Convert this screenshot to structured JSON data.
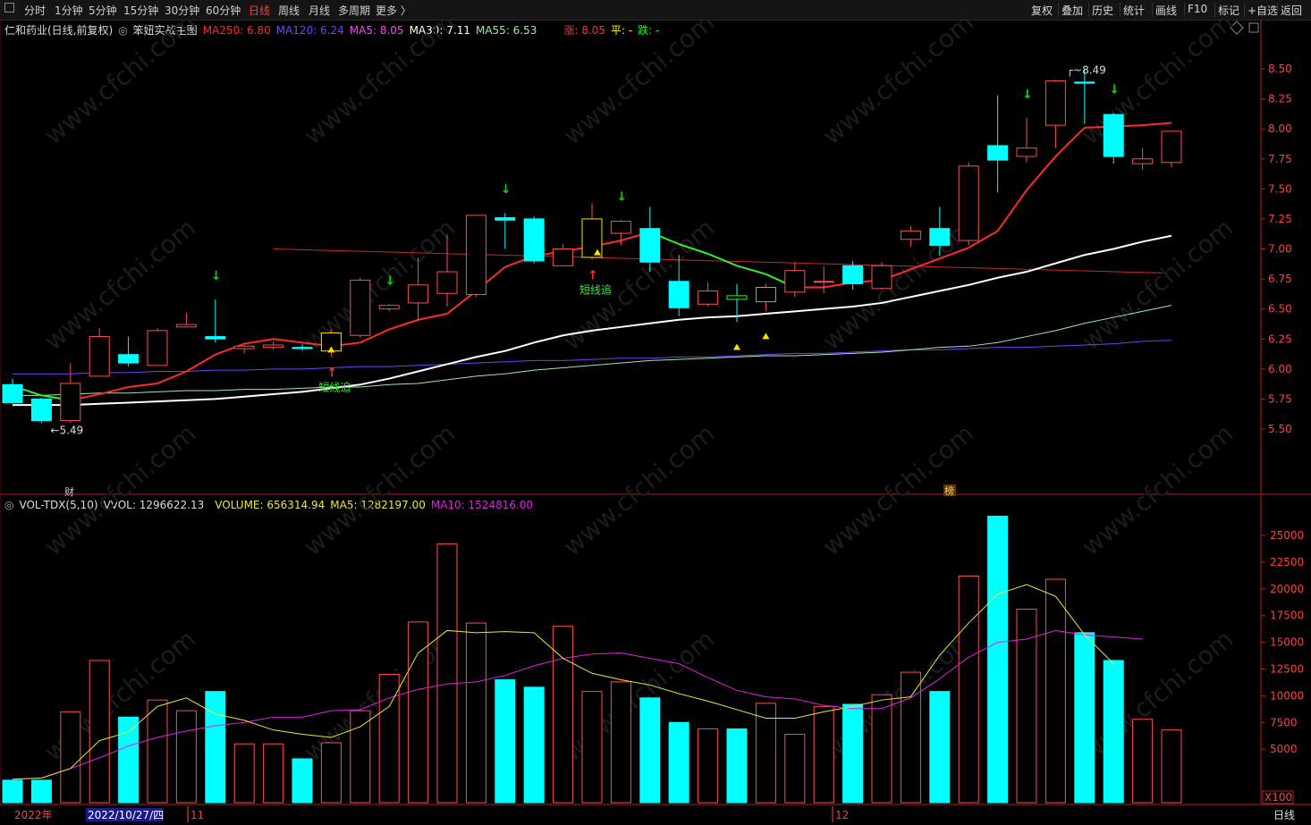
{
  "period_tabs": [
    "分时",
    "1分钟",
    "5分钟",
    "15分钟",
    "30分钟",
    "60分钟",
    "日线",
    "周线",
    "月线",
    "多周期",
    "更多 〉"
  ],
  "active_period": "日线",
  "toolbar": [
    "复权",
    "叠加",
    "历史",
    "统计",
    "画线",
    "F10",
    "标记",
    "+自选",
    "返回"
  ],
  "main_legend": {
    "stock": "仁和药业(日线,前复权)",
    "indicator": "笨妞实战主图",
    "ma250": "MA250: 6.80",
    "ma120": "MA120: 6.24",
    "ma5": "MA5: 8.05",
    "ma30": "MA30: 7.11",
    "ma55": "MA55: 6.53",
    "zhang": "涨: 8.05",
    "ping": "平: -",
    "die": "跌: -"
  },
  "vol_legend": {
    "name": "VOL-TDX(5,10)",
    "vvol": "VVOL: 1296622.13",
    "volume": "VOLUME: 656314.94",
    "ma5": "MA5: 1282197.00",
    "ma10": "MA10: 1524816.00"
  },
  "colors": {
    "up": "#ff4d4d",
    "down": "#00ffff",
    "ma5": "#ff2a2a",
    "ma30": "#ffffff",
    "ma55": "#9fe8a8",
    "ma120": "#7a3cff",
    "ma250": "#c82828",
    "vma5": "#e8e838",
    "vma10": "#e020e0",
    "signal": "#00dd00",
    "tri": "#ffe000",
    "zhuiArrow": "#ff2a2a"
  },
  "x_axis": {
    "labels": [
      "2022年",
      "2022/10/27/四",
      "11",
      "12"
    ],
    "bottom_right": "日线"
  },
  "vol_unit": "X100",
  "markers": {
    "cai": "财",
    "bang": "榜"
  },
  "chart_data": {
    "type": "candlestick",
    "price_axis": {
      "ticks": [
        5.5,
        5.75,
        6.0,
        6.25,
        6.5,
        6.75,
        7.0,
        7.25,
        7.5,
        7.75,
        8.0,
        8.25,
        8.5
      ]
    },
    "volume_axis": {
      "ticks": [
        5000,
        7500,
        10000,
        12500,
        15000,
        17500,
        20000,
        22500,
        25000
      ]
    },
    "candles": [
      {
        "o": 5.87,
        "h": 5.92,
        "l": 5.71,
        "c": 5.72,
        "v": 2100
      },
      {
        "o": 5.75,
        "h": 5.76,
        "l": 5.55,
        "c": 5.57,
        "v": 2100
      },
      {
        "o": 5.57,
        "h": 6.05,
        "l": 5.55,
        "c": 5.88,
        "v": 8500
      },
      {
        "o": 5.94,
        "h": 6.34,
        "l": 5.94,
        "c": 6.27,
        "v": 13300
      },
      {
        "o": 6.12,
        "h": 6.27,
        "l": 6.02,
        "c": 6.05,
        "v": 8000
      },
      {
        "o": 6.03,
        "h": 6.34,
        "l": 6.03,
        "c": 6.32,
        "v": 9600
      },
      {
        "o": 6.35,
        "h": 6.47,
        "l": 6.35,
        "c": 6.37,
        "v": 8600
      },
      {
        "o": 6.27,
        "h": 6.58,
        "l": 6.22,
        "c": 6.25,
        "v": 10400
      },
      {
        "o": 6.17,
        "h": 6.2,
        "l": 6.13,
        "c": 6.19,
        "v": 5500
      },
      {
        "o": 6.18,
        "h": 6.23,
        "l": 6.16,
        "c": 6.2,
        "v": 5500
      },
      {
        "o": 6.18,
        "h": 6.21,
        "l": 6.15,
        "c": 6.17,
        "v": 4100
      },
      {
        "o": 6.15,
        "h": 6.33,
        "l": 6.1,
        "c": 6.3,
        "v": 5600
      },
      {
        "o": 6.28,
        "h": 6.76,
        "l": 6.26,
        "c": 6.74,
        "v": 8600
      },
      {
        "o": 6.5,
        "h": 6.54,
        "l": 6.48,
        "c": 6.53,
        "v": 12000
      },
      {
        "o": 6.55,
        "h": 6.93,
        "l": 6.4,
        "c": 6.7,
        "v": 16900
      },
      {
        "o": 6.63,
        "h": 7.12,
        "l": 6.52,
        "c": 6.81,
        "v": 24200
      },
      {
        "o": 6.62,
        "h": 7.28,
        "l": 6.6,
        "c": 7.28,
        "v": 16800
      },
      {
        "o": 7.26,
        "h": 7.3,
        "l": 7.0,
        "c": 7.24,
        "v": 11500
      },
      {
        "o": 7.25,
        "h": 7.27,
        "l": 6.88,
        "c": 6.9,
        "v": 10800
      },
      {
        "o": 6.86,
        "h": 7.04,
        "l": 6.86,
        "c": 7.0,
        "v": 16500
      },
      {
        "o": 6.93,
        "h": 7.38,
        "l": 6.91,
        "c": 7.25,
        "v": 10400
      },
      {
        "o": 7.13,
        "h": 7.24,
        "l": 7.03,
        "c": 7.23,
        "v": 11300
      },
      {
        "o": 7.17,
        "h": 7.35,
        "l": 6.81,
        "c": 6.89,
        "v": 9800
      },
      {
        "o": 6.73,
        "h": 6.95,
        "l": 6.44,
        "c": 6.51,
        "v": 7500
      },
      {
        "o": 6.54,
        "h": 6.72,
        "l": 6.52,
        "c": 6.65,
        "v": 6900
      },
      {
        "o": 6.61,
        "h": 6.71,
        "l": 6.39,
        "c": 6.58,
        "v": 6900
      },
      {
        "o": 6.56,
        "h": 6.71,
        "l": 6.48,
        "c": 6.68,
        "v": 9300
      },
      {
        "o": 6.64,
        "h": 6.89,
        "l": 6.6,
        "c": 6.82,
        "v": 6400
      },
      {
        "o": 6.73,
        "h": 6.86,
        "l": 6.63,
        "c": 6.73,
        "v": 9000
      },
      {
        "o": 6.86,
        "h": 6.9,
        "l": 6.66,
        "c": 6.71,
        "v": 9200
      },
      {
        "o": 6.67,
        "h": 6.89,
        "l": 6.66,
        "c": 6.86,
        "v": 10100
      },
      {
        "o": 7.08,
        "h": 7.19,
        "l": 7.02,
        "c": 7.15,
        "v": 12200
      },
      {
        "o": 7.17,
        "h": 7.35,
        "l": 6.94,
        "c": 7.03,
        "v": 10400
      },
      {
        "o": 7.07,
        "h": 7.72,
        "l": 7.03,
        "c": 7.69,
        "v": 21200
      },
      {
        "o": 7.86,
        "h": 8.28,
        "l": 7.47,
        "c": 7.74,
        "v": 26800
      },
      {
        "o": 7.77,
        "h": 8.09,
        "l": 7.72,
        "c": 7.84,
        "v": 18100
      },
      {
        "o": 8.03,
        "h": 8.41,
        "l": 7.84,
        "c": 8.4,
        "v": 20900
      },
      {
        "o": 8.39,
        "h": 8.49,
        "l": 8.04,
        "c": 8.38,
        "v": 15900
      },
      {
        "o": 8.12,
        "h": 8.13,
        "l": 7.71,
        "c": 7.77,
        "v": 13300
      },
      {
        "o": 7.71,
        "h": 7.84,
        "l": 7.66,
        "c": 7.75,
        "v": 7800
      },
      {
        "o": 7.72,
        "h": 7.98,
        "l": 7.68,
        "c": 7.98,
        "v": 6800
      }
    ],
    "ma5": [
      5.86,
      5.78,
      5.74,
      5.79,
      5.85,
      5.88,
      5.98,
      6.12,
      6.21,
      6.25,
      6.22,
      6.19,
      6.22,
      6.33,
      6.41,
      6.46,
      6.65,
      6.85,
      6.94,
      6.98,
      7.02,
      7.07,
      7.14,
      7.04,
      6.96,
      6.86,
      6.79,
      6.68,
      6.68,
      6.72,
      6.74,
      6.83,
      6.92,
      7.01,
      7.15,
      7.49,
      7.77,
      8.01,
      8.02,
      8.03,
      8.05
    ],
    "ma30": [
      5.7,
      5.7,
      5.7,
      5.71,
      5.72,
      5.73,
      5.74,
      5.75,
      5.77,
      5.79,
      5.81,
      5.84,
      5.87,
      5.92,
      5.98,
      6.04,
      6.1,
      6.15,
      6.22,
      6.28,
      6.32,
      6.35,
      6.38,
      6.41,
      6.43,
      6.44,
      6.46,
      6.48,
      6.5,
      6.52,
      6.55,
      6.6,
      6.65,
      6.7,
      6.76,
      6.81,
      6.88,
      6.95,
      7.0,
      7.06,
      7.11
    ],
    "ma55": [
      5.78,
      5.78,
      5.79,
      5.8,
      5.8,
      5.81,
      5.82,
      5.82,
      5.83,
      5.83,
      5.84,
      5.85,
      5.85,
      5.87,
      5.88,
      5.91,
      5.94,
      5.96,
      5.99,
      6.01,
      6.03,
      6.05,
      6.07,
      6.08,
      6.09,
      6.1,
      6.11,
      6.11,
      6.12,
      6.13,
      6.14,
      6.16,
      6.18,
      6.19,
      6.22,
      6.27,
      6.32,
      6.38,
      6.43,
      6.48,
      6.53
    ],
    "ma120": [
      5.96,
      5.96,
      5.96,
      5.97,
      5.97,
      5.98,
      5.98,
      5.99,
      5.99,
      6.0,
      6.0,
      6.01,
      6.02,
      6.02,
      6.03,
      6.04,
      6.05,
      6.06,
      6.07,
      6.07,
      6.08,
      6.09,
      6.09,
      6.1,
      6.1,
      6.11,
      6.12,
      6.13,
      6.13,
      6.14,
      6.15,
      6.16,
      6.16,
      6.17,
      6.18,
      6.18,
      6.19,
      6.2,
      6.21,
      6.23,
      6.24
    ],
    "ma250": {
      "start_index": 9,
      "start": 7.0,
      "end": 6.8
    },
    "vma5": [
      2200,
      2300,
      3200,
      5800,
      6600,
      9000,
      9800,
      8300,
      7700,
      6800,
      6400,
      6100,
      7100,
      9000,
      14000,
      16100,
      15900,
      16000,
      15900,
      13500,
      12100,
      11500,
      11000,
      10200,
      9500,
      8700,
      7900,
      7900,
      8500,
      9000,
      9600,
      9900,
      13800,
      16800,
      19500,
      20400,
      19300,
      15700,
      13000
    ],
    "vma10": [
      2200,
      2300,
      3200,
      4200,
      5300,
      6100,
      6700,
      7200,
      7500,
      8000,
      8000,
      8600,
      8700,
      9800,
      10600,
      11100,
      11300,
      11900,
      12800,
      13500,
      13900,
      14000,
      13500,
      13000,
      11700,
      10500,
      9900,
      9700,
      9100,
      8800,
      8800,
      9800,
      11600,
      13600,
      15000,
      15300,
      16100,
      15700,
      15500,
      15300
    ],
    "annotations": {
      "high": {
        "index": 37,
        "label": "8.49"
      },
      "low": {
        "index": 1,
        "label": "5.49"
      },
      "down_arrows": [
        7,
        13,
        17,
        21,
        35,
        38
      ],
      "zhui": [
        {
          "index": 11,
          "label": "短线追"
        },
        {
          "index": 20,
          "label": "短线追"
        }
      ],
      "triangles": [
        11,
        20,
        25,
        26
      ],
      "boxes": [
        11,
        20,
        25,
        26
      ]
    }
  }
}
